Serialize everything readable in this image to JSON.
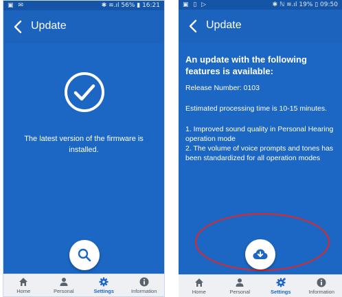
{
  "left_screen": {
    "status": {
      "left_icons": "▣ ✉",
      "right": "✱ ≋.ıl 56% ▮ 16:21"
    },
    "title": "Update",
    "message": "The latest version of the firmware is installed.",
    "nav": [
      {
        "label": "Home",
        "icon": "home-icon"
      },
      {
        "label": "Personal",
        "icon": "person-icon"
      },
      {
        "label": "Settings",
        "icon": "gear-icon",
        "active": true
      },
      {
        "label": "Information",
        "icon": "info-icon"
      }
    ]
  },
  "right_screen": {
    "status": {
      "left_icons": "▣ ▯ ▷",
      "right": "✱ ℕ ≋.ıl 19% ▯ 09:50"
    },
    "title": "Update",
    "heading": "An update with the following features is available:",
    "release": "Release Number: 0103",
    "processing": "Estimated processing time is 10-15 minutes.",
    "features": [
      "1. Improved sound quality in Personal Hearing operation mode",
      "2. The volume of voice prompts and tones has been standardized for all operation modes"
    ],
    "nav": [
      {
        "label": "Home",
        "icon": "home-icon"
      },
      {
        "label": "Personal",
        "icon": "person-icon"
      },
      {
        "label": "Settings",
        "icon": "gear-icon",
        "active": true
      },
      {
        "label": "Information",
        "icon": "info-icon"
      }
    ]
  },
  "colors": {
    "primary": "#1c67c4",
    "nav_background": "#eef0f3",
    "highlight": "#e32626"
  }
}
